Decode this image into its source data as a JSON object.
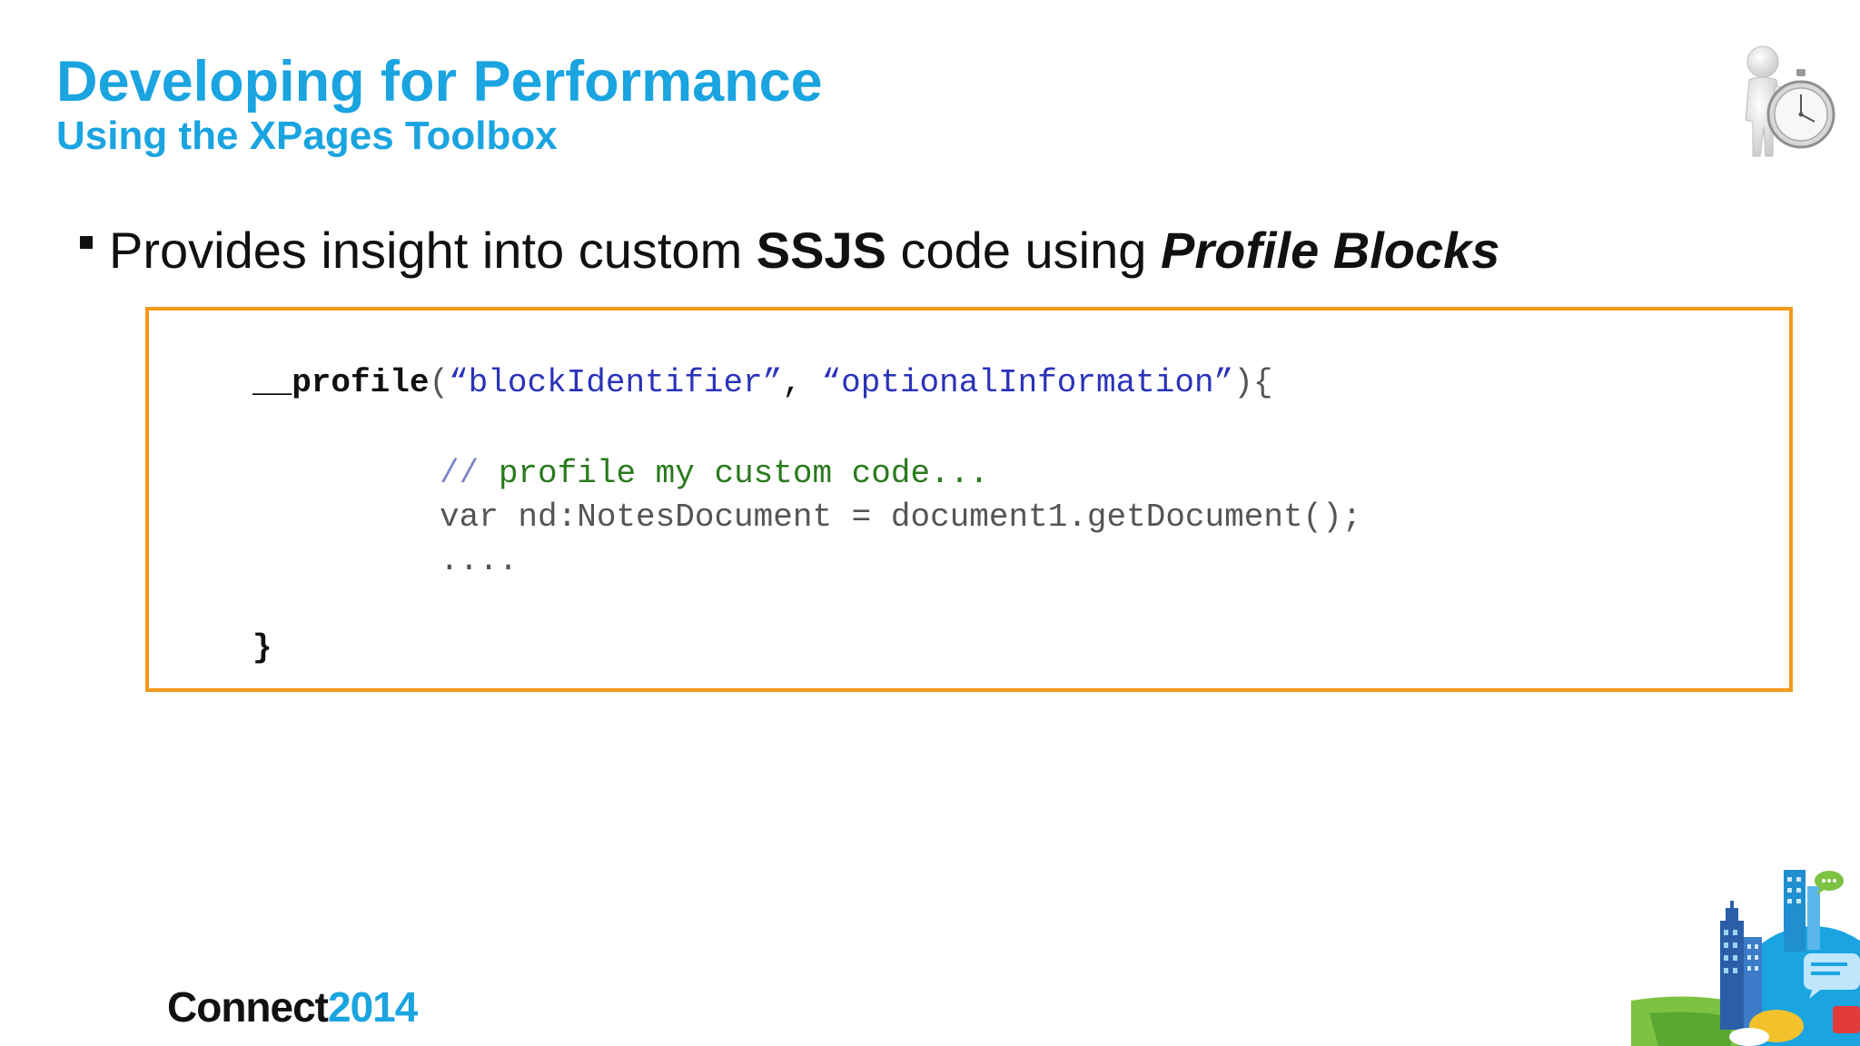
{
  "slide": {
    "title": "Developing for Performance",
    "subtitle": "Using the XPages Toolbox",
    "bullet": {
      "prefix": "Provides insight into custom ",
      "bold_1": "SSJS",
      "middle": " code using ",
      "bold_italic_2": "Profile Blocks"
    },
    "code": {
      "line1_keyword": "__profile",
      "line1_open": "(",
      "line1_arg1": "“blockIdentifier”",
      "line1_comma": ", ",
      "line1_arg2": "“optionalInformation”",
      "line1_close": "){",
      "line2_slash": "//",
      "line2_comment": " profile my custom code...",
      "line3": "var nd:NotesDocument = document1.getDocument();",
      "line4": "....",
      "line5": "}"
    },
    "footer": {
      "logo_word": "Connect",
      "logo_year": "2014"
    }
  },
  "colors": {
    "title": "#1aa4e0",
    "box_border": "#f39a1c",
    "code_string": "#2a33b8",
    "code_comment": "#2a7a1e",
    "code_plain": "#555555"
  },
  "icons": {
    "top_right": "figure-with-stopwatch-icon",
    "bottom_right": "connect-city-illustration"
  }
}
